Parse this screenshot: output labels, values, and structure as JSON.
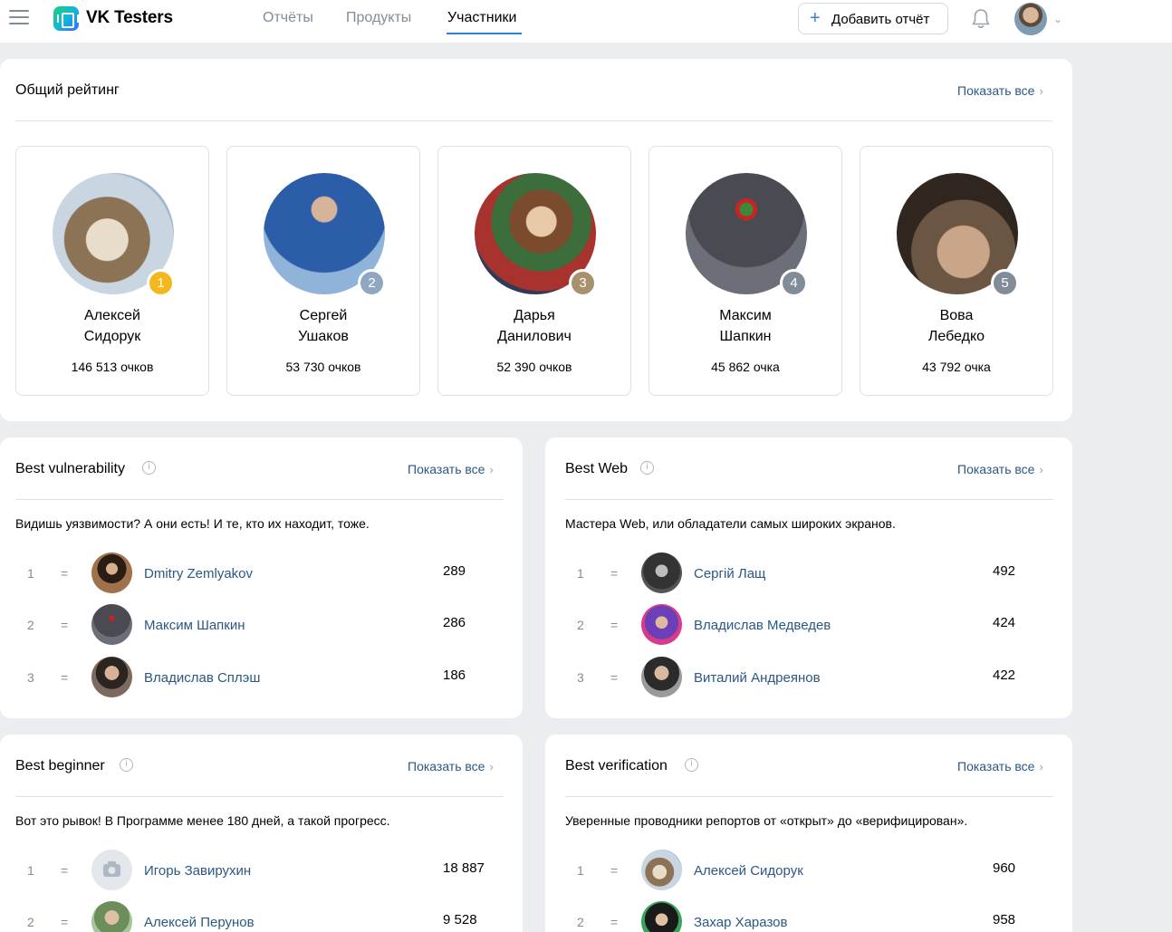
{
  "header": {
    "logo_text": "VK Testers",
    "nav": [
      {
        "label": "Отчёты"
      },
      {
        "label": "Продукты"
      },
      {
        "label": "Участники",
        "active": true
      }
    ],
    "add_report_label": "Добавить отчёт",
    "add_icon": "plus-icon",
    "bell_icon": "bell-icon"
  },
  "overall": {
    "title": "Общий рейтинг",
    "show_all": "Показать все",
    "people": [
      {
        "rank": "1",
        "first": "Алексей",
        "last": "Сидорук",
        "score": "146 513 очков"
      },
      {
        "rank": "2",
        "first": "Сергей",
        "last": "Ушаков",
        "score": "53 730 очков"
      },
      {
        "rank": "3",
        "first": "Дарья",
        "last": "Данилович",
        "score": "52 390 очков"
      },
      {
        "rank": "4",
        "first": "Максим",
        "last": "Шапкин",
        "score": "45 862 очка"
      },
      {
        "rank": "5",
        "first": "Вова",
        "last": "Лебедко",
        "score": "43 792 очка"
      }
    ]
  },
  "best_vulnerability": {
    "title": "Best vulnerability",
    "show_all": "Показать все",
    "description": "Видишь уязвимости? А они есть! И те, кто их находит, тоже.",
    "rows": [
      {
        "rank": "1",
        "trend": "=",
        "name": "Dmitry Zemlyakov",
        "score": "289"
      },
      {
        "rank": "2",
        "trend": "=",
        "name": "Максим Шапкин",
        "score": "286"
      },
      {
        "rank": "3",
        "trend": "=",
        "name": "Владислав Сплэш",
        "score": "186"
      }
    ]
  },
  "best_web": {
    "title": "Best Web",
    "show_all": "Показать все",
    "description": "Мастера Web, или обладатели самых широких экранов.",
    "rows": [
      {
        "rank": "1",
        "trend": "=",
        "name": "Сергій Лащ",
        "score": "492"
      },
      {
        "rank": "2",
        "trend": "=",
        "name": "Владислав Медведев",
        "score": "424"
      },
      {
        "rank": "3",
        "trend": "=",
        "name": "Виталий Андреянов",
        "score": "422"
      }
    ]
  },
  "best_beginner": {
    "title": "Best beginner",
    "show_all": "Показать все",
    "description": "Вот это рывок! В Программе менее 180 дней, а такой прогресс.",
    "rows": [
      {
        "rank": "1",
        "trend": "=",
        "name": "Игорь Завирухин",
        "score": "18 887"
      },
      {
        "rank": "2",
        "trend": "=",
        "name": "Алексей Перунов",
        "score": "9 528"
      }
    ]
  },
  "best_verification": {
    "title": "Best verification",
    "show_all": "Показать все",
    "description": "Уверенные проводники репортов от «открыт» до «верифицирован».",
    "rows": [
      {
        "rank": "1",
        "trend": "=",
        "name": "Алексей Сидорук",
        "score": "960"
      },
      {
        "rank": "2",
        "trend": "=",
        "name": "Захар Харазов",
        "score": "958"
      }
    ]
  },
  "colors": {
    "accent": "#2d81e0",
    "link": "#2a5885",
    "gold": "#f5b81c",
    "silver": "#8fa7c1",
    "bronze": "#a8926e",
    "grey_badge": "#818c99"
  }
}
